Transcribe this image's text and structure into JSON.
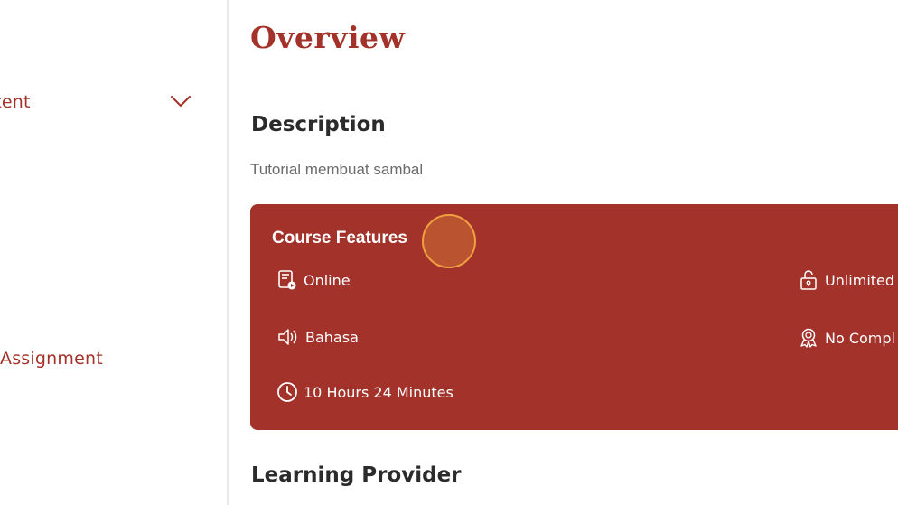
{
  "sidebar": {
    "items": [
      {
        "label": "ntent"
      },
      {
        "label": "Assignment"
      }
    ]
  },
  "main": {
    "title": "Overview",
    "description": {
      "heading": "Description",
      "text": "Tutorial membuat sambal"
    },
    "course_features": {
      "title": "Course Features",
      "items": [
        {
          "label": "Online",
          "icon": "online-course-icon"
        },
        {
          "label": "Bahasa",
          "icon": "speaker-icon"
        },
        {
          "label": "10 Hours 24 Minutes",
          "icon": "clock-icon"
        },
        {
          "label": "Unlimited",
          "icon": "unlock-icon"
        },
        {
          "label": "No Compl",
          "icon": "certificate-icon"
        }
      ]
    },
    "learning_provider": {
      "heading": "Learning Provider"
    }
  },
  "colors": {
    "accent": "#a3322a",
    "heading_text": "#2b2b2b",
    "muted_text": "#6b6b6b",
    "cursor_highlight": "#f0a040"
  }
}
